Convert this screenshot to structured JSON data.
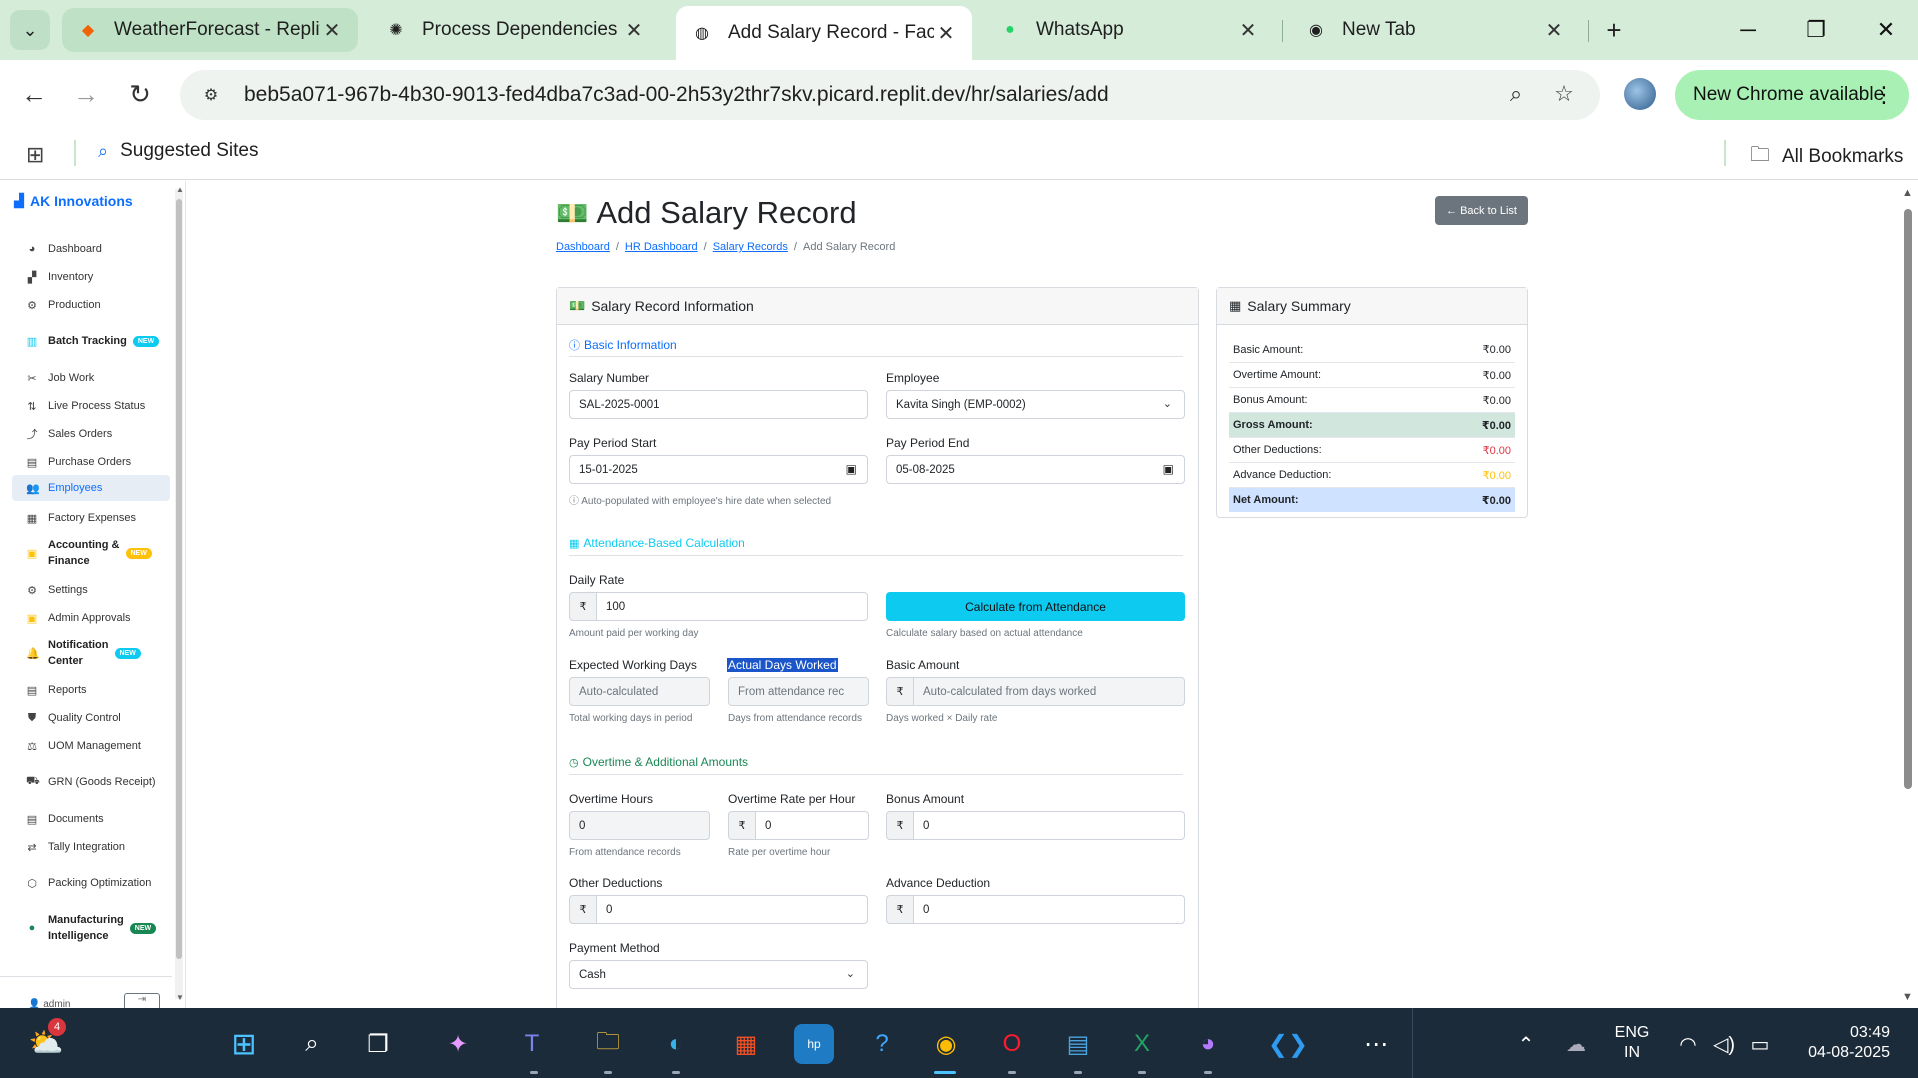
{
  "browser": {
    "tabs": [
      {
        "title": "WeatherForecast - Replit",
        "icon": "replit-icon"
      },
      {
        "title": "Process Dependencies O",
        "icon": "openai-icon"
      },
      {
        "title": "Add Salary Record - Facto",
        "icon": "globe-icon"
      },
      {
        "title": "WhatsApp",
        "icon": "whatsapp-icon"
      },
      {
        "title": "New Tab",
        "icon": "chrome-icon"
      }
    ],
    "url": "beb5a071-967b-4b30-9013-fed4dba7c3ad-00-2h53y2thr7skv.picard.replit.dev/hr/salaries/add",
    "new_chrome_label": "New Chrome available",
    "bookmarks": {
      "suggested": "Suggested Sites",
      "all": "All Bookmarks"
    }
  },
  "sidebar": {
    "brand": "AK Innovations",
    "items": [
      {
        "label": "Dashboard",
        "icon": "dashboard-icon"
      },
      {
        "label": "Inventory",
        "icon": "inventory-icon"
      },
      {
        "label": "Production",
        "icon": "production-icon"
      },
      {
        "label": "Batch Tracking",
        "icon": "batch-icon",
        "badge": "NEW"
      },
      {
        "label": "Job Work",
        "icon": "job-work-icon"
      },
      {
        "label": "Live Process Status",
        "icon": "process-icon"
      },
      {
        "label": "Sales Orders",
        "icon": "sales-icon"
      },
      {
        "label": "Purchase Orders",
        "icon": "purchase-icon"
      },
      {
        "label": "Employees",
        "icon": "employees-icon"
      },
      {
        "label": "Factory Expenses",
        "icon": "expenses-icon"
      },
      {
        "label": "Accounting &",
        "label2": "Finance",
        "icon": "accounting-icon",
        "badge": "NEW"
      },
      {
        "label": "Settings",
        "icon": "settings-icon"
      },
      {
        "label": "Admin Approvals",
        "icon": "approvals-icon"
      },
      {
        "label": "Notification",
        "label2": "Center",
        "icon": "bell-icon",
        "badge": "NEW"
      },
      {
        "label": "Reports",
        "icon": "reports-icon"
      },
      {
        "label": "Quality Control",
        "icon": "shield-icon"
      },
      {
        "label": "UOM Management",
        "icon": "scale-icon"
      },
      {
        "label": "GRN (Goods Receipt)",
        "icon": "truck-icon"
      },
      {
        "label": "Documents",
        "icon": "document-icon"
      },
      {
        "label": "Tally Integration",
        "icon": "sync-icon"
      },
      {
        "label": "Packing Optimization",
        "icon": "box-icon"
      },
      {
        "label": "Manufacturing",
        "label2": "Intelligence",
        "icon": "brain-icon",
        "badge": "NEW"
      }
    ],
    "user": "admin"
  },
  "page": {
    "title": "Add Salary Record",
    "back_label": "Back to List",
    "breadcrumb": [
      "Dashboard",
      "HR Dashboard",
      "Salary Records",
      "Add Salary Record"
    ]
  },
  "form": {
    "card_title": "Salary Record Information",
    "sections": {
      "basic": "Basic Information",
      "attendance": "Attendance-Based Calculation",
      "overtime": "Overtime & Additional Amounts"
    },
    "salary_number": {
      "label": "Salary Number",
      "value": "SAL-2025-0001"
    },
    "employee": {
      "label": "Employee",
      "value": "Kavita Singh (EMP-0002)"
    },
    "pay_start": {
      "label": "Pay Period Start",
      "value": "15-01-2025"
    },
    "pay_end": {
      "label": "Pay Period End",
      "value": "05-08-2025"
    },
    "pay_help": "Auto-populated with employee's hire date when selected",
    "daily_rate": {
      "label": "Daily Rate",
      "prefix": "₹",
      "value": "100",
      "help": "Amount paid per working day"
    },
    "calc_button": {
      "label": "Calculate from Attendance",
      "help": "Calculate salary based on actual attendance"
    },
    "expected_days": {
      "label": "Expected Working Days",
      "placeholder": "Auto-calculated",
      "help": "Total working days in period"
    },
    "actual_days": {
      "label": "Actual Days Worked",
      "placeholder": "From attendance rec",
      "help": "Days from attendance records"
    },
    "basic_amount": {
      "label": "Basic Amount",
      "prefix": "₹",
      "placeholder": "Auto-calculated from days worked",
      "help": "Days worked × Daily rate"
    },
    "overtime_hours": {
      "label": "Overtime Hours",
      "value": "0",
      "help": "From attendance records"
    },
    "overtime_rate": {
      "label": "Overtime Rate per Hour",
      "prefix": "₹",
      "value": "0",
      "help": "Rate per overtime hour"
    },
    "bonus_amount": {
      "label": "Bonus Amount",
      "prefix": "₹",
      "value": "0"
    },
    "other_deductions": {
      "label": "Other Deductions",
      "prefix": "₹",
      "value": "0"
    },
    "advance_deduction": {
      "label": "Advance Deduction",
      "prefix": "₹",
      "value": "0"
    },
    "payment_method": {
      "label": "Payment Method",
      "value": "Cash"
    }
  },
  "summary": {
    "title": "Salary Summary",
    "rows": [
      {
        "label": "Basic Amount:",
        "value": "₹0.00"
      },
      {
        "label": "Overtime Amount:",
        "value": "₹0.00"
      },
      {
        "label": "Bonus Amount:",
        "value": "₹0.00"
      },
      {
        "label": "Gross Amount:",
        "value": "₹0.00"
      },
      {
        "label": "Other Deductions:",
        "value": "₹0.00"
      },
      {
        "label": "Advance Deduction:",
        "value": "₹0.00"
      },
      {
        "label": "Net Amount:",
        "value": "₹0.00"
      }
    ]
  },
  "taskbar": {
    "weather_badge": "4",
    "lang": "ENG",
    "region": "IN",
    "time": "03:49",
    "date": "04-08-2025"
  },
  "colors": {
    "primary": "#0d6efd",
    "info": "#0dcaf0",
    "success": "#198754",
    "danger": "#dc3545",
    "warning": "#ffc107",
    "chrome_tab_bg": "#d4ecd8"
  }
}
